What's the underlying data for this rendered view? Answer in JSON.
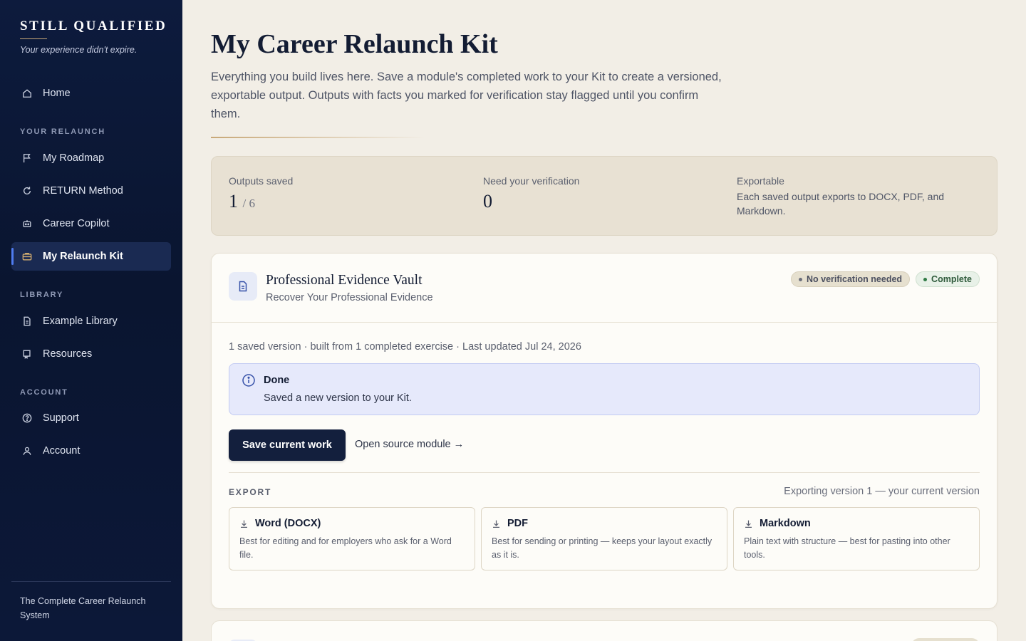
{
  "brand": {
    "name": "STILL QUALIFIED",
    "tagline": "Your experience didn't expire."
  },
  "sidebar": {
    "home": "Home",
    "sections": {
      "relaunch": "YOUR RELAUNCH",
      "library": "LIBRARY",
      "account": "ACCOUNT"
    },
    "items": {
      "roadmap": "My Roadmap",
      "return_method": "RETURN Method",
      "copilot": "Career Copilot",
      "kit": "My Relaunch Kit",
      "examples": "Example Library",
      "resources": "Resources",
      "support": "Support",
      "account": "Account"
    },
    "footer": "The Complete Career Relaunch System"
  },
  "page": {
    "title": "My Career Relaunch Kit",
    "description": "Everything you build lives here. Save a module's completed work to your Kit to create a versioned, exportable output. Outputs with facts you marked for verification stay flagged until you confirm them."
  },
  "stats": {
    "outputs_label": "Outputs saved",
    "outputs_value": "1",
    "outputs_total": "/ 6",
    "verify_label": "Need your verification",
    "verify_value": "0",
    "export_label": "Exportable",
    "export_text": "Each saved output exports to DOCX, PDF, and Markdown."
  },
  "card": {
    "title": "Professional Evidence Vault",
    "subtitle": "Recover Your Professional Evidence",
    "badge_verification": "No verification needed",
    "badge_status": "Complete",
    "meta": "1 saved version · built from 1 completed exercise · Last updated Jul 24, 2026",
    "alert_title": "Done",
    "alert_body": "Saved a new version to your Kit.",
    "save_button": "Save current work",
    "open_link": "Open source module →",
    "export_heading": "EXPORT",
    "export_note": "Exporting version 1 — your current version",
    "exports": {
      "docx": {
        "title": "Word (DOCX)",
        "desc": "Best for editing and for employers who ask for a Word file."
      },
      "pdf": {
        "title": "PDF",
        "desc": "Best for sending or printing — keeps your layout exactly as it is."
      },
      "md": {
        "title": "Markdown",
        "desc": "Plain text with structure — best for pasting into other tools."
      }
    }
  },
  "colors": {
    "sidebar_bg": "#0d1b3d",
    "accent": "#4f7cf0",
    "gold": "#c8a878",
    "primary_button": "#131f3d",
    "page_bg": "#f2eee6"
  }
}
